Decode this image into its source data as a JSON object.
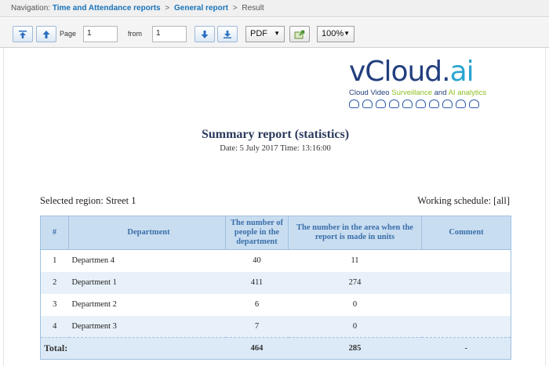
{
  "navigation": {
    "prefix": "Navigation:",
    "crumb1": "Time and Attendance reports",
    "sep": ">",
    "crumb2": "General report",
    "current": "Result"
  },
  "toolbar": {
    "page_label": "Page",
    "page_value": "1",
    "from_label": "from",
    "from_value": "1",
    "format": "PDF",
    "zoom": "100%",
    "caret": "▼"
  },
  "logo": {
    "name_main": "vCloud.",
    "name_accent": "ai",
    "tagline_a": "Cloud Video ",
    "tagline_b": "Surveillance",
    "tagline_c": " and ",
    "tagline_d": "AI analytics"
  },
  "report": {
    "title": "Summary report (statistics)",
    "date_line": "Date: 5 July 2017 Time: 13:16:00",
    "region": "Selected region: Street 1",
    "schedule": "Working schedule: [all]",
    "columns": {
      "num": "#",
      "department": "Department",
      "people": "The number of people in the department",
      "area": "The number in the area when the report is made in units",
      "comment": "Comment"
    },
    "rows": [
      {
        "num": "1",
        "department": "Departmen 4",
        "people": "40",
        "area": "11",
        "comment": ""
      },
      {
        "num": "2",
        "department": "Department 1",
        "people": "411",
        "area": "274",
        "comment": ""
      },
      {
        "num": "3",
        "department": "Department 2",
        "people": "6",
        "area": "0",
        "comment": ""
      },
      {
        "num": "4",
        "department": "Department 3",
        "people": "7",
        "area": "0",
        "comment": ""
      }
    ],
    "total": {
      "label": "Total:",
      "people": "464",
      "area": "285",
      "comment": "-"
    }
  }
}
